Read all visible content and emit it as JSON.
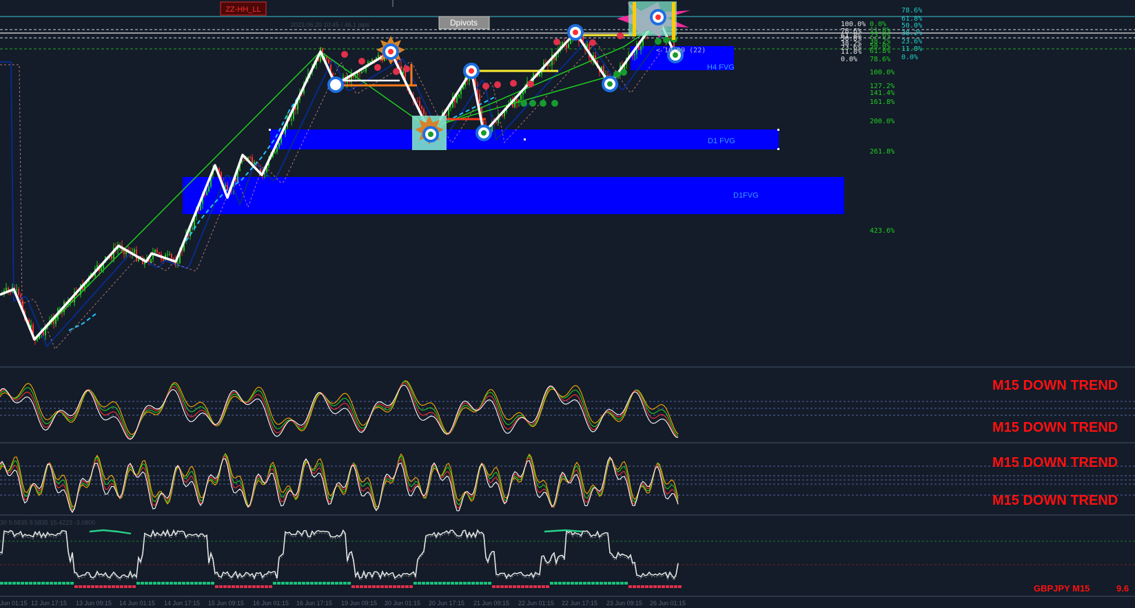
{
  "window": {
    "symbol_label": "GBPJPY M15",
    "last_value": "9.6"
  },
  "toolbar": {
    "zz_button": "ZZ-HH_LL",
    "dpivots_button": "Dpivots"
  },
  "main_chart": {
    "info_text": "2023.06.20 10:45 / 46.1 pips",
    "countdown": "< 10:09 (22)",
    "zones": [
      {
        "label": "H4 FVG"
      },
      {
        "label": "D1 FVG"
      },
      {
        "label": "D1FVG"
      }
    ],
    "fib_right_col": [
      "78.6%",
      "61.8%",
      "50.0%",
      "38.2%",
      "23.6%",
      "11.8%",
      "0.0%"
    ],
    "fib_left_stack": [
      "100.0%",
      "78.6%",
      "61.8%",
      "50.0%",
      "38.2%",
      "23.6%",
      "11.8%",
      "0.0%"
    ],
    "fib_mid_stack": [
      "0.0%",
      "11.8%",
      "23.6%",
      "38.2%",
      "50.0%",
      "61.8%",
      "78.6%"
    ],
    "fib_ext_levels": [
      "100.0%",
      "127.2%",
      "141.4%",
      "161.8%",
      "200.0%",
      "261.8%",
      "423.6%"
    ]
  },
  "indicators": {
    "trend_labels": [
      "M15 DOWN TREND",
      "M15 DOWN TREND",
      "M15 DOWN TREND",
      "M15 DOWN TREND"
    ],
    "panel3_header": "30 9.5835 9.5835 15.4223 -3.0800"
  },
  "time_axis": [
    "Jun 01:15",
    "12 Jun 17:15",
    "13 Jun 09:15",
    "14 Jun 01:15",
    "14 Jun 17:15",
    "15 Jun 09:15",
    "16 Jun 01:15",
    "16 Jun 17:15",
    "19 Jun 09:15",
    "20 Jun 01:15",
    "20 Jun 17:15",
    "21 Jun 09:15",
    "22 Jun 01:15",
    "22 Jun 17:15",
    "23 Jun 09:15",
    "26 Jun 01:15"
  ],
  "colors": {
    "background": "#131c28",
    "fvg_zone": "#0000ff",
    "trend_text": "#ff1010",
    "fib_green": "#22cc22",
    "fib_cyan": "#22cccc",
    "zigzag": "#ffffff",
    "trendline": "#22cc22",
    "pivot_yellow": "#ffee33"
  },
  "icons": [
    "pivot-circle-marker",
    "sun-burst-marker",
    "magenta-star-marker",
    "red-dot-marker",
    "green-dot-marker"
  ]
}
